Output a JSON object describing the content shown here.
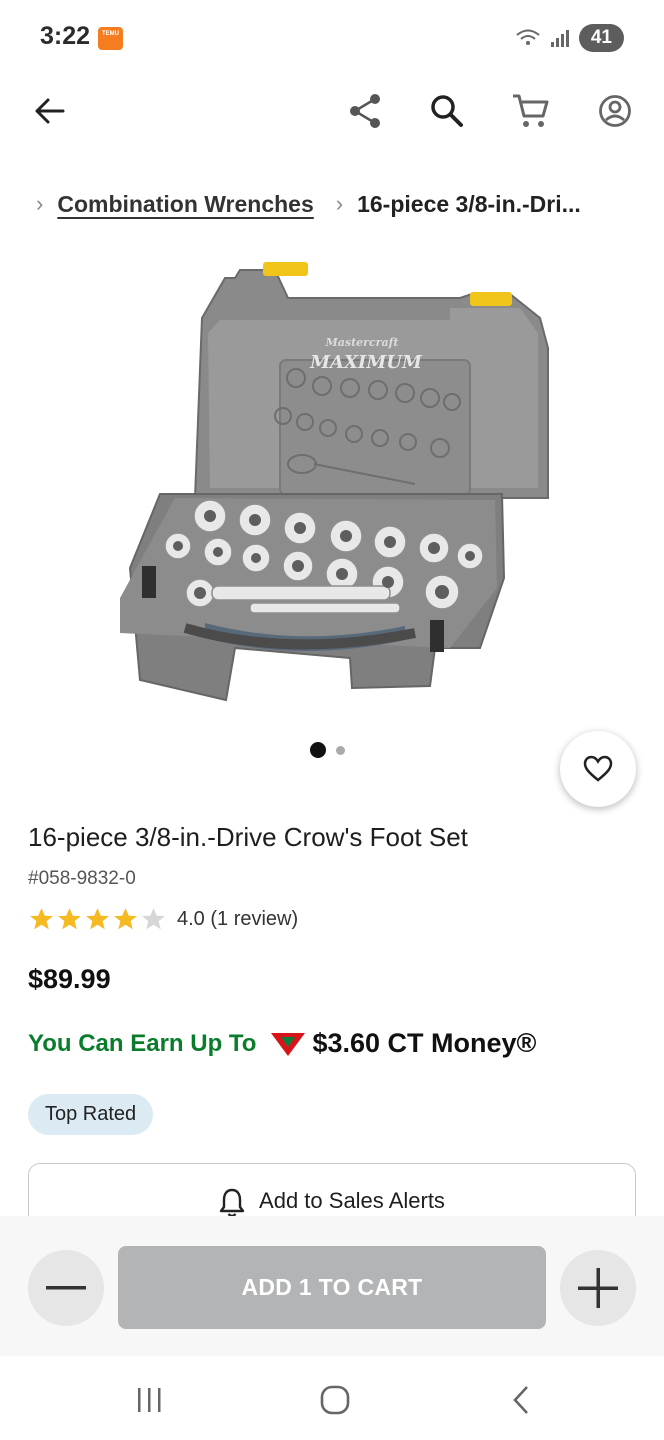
{
  "status_bar": {
    "time": "3:22",
    "app_icon_text": "TEMU",
    "battery": "41"
  },
  "top_nav": {
    "back_icon": "arrow-left-icon",
    "share_icon": "share-icon",
    "search_icon": "search-icon",
    "cart_icon": "cart-icon",
    "account_icon": "account-icon"
  },
  "breadcrumb": {
    "items": [
      {
        "label": "Combination Wrenches"
      },
      {
        "label": "16-piece 3/8-in.-Dri..."
      }
    ]
  },
  "product": {
    "image_brand_text": "Mastercraft",
    "image_model_text": "MAXIMUM",
    "image_count": 2,
    "active_image": 1,
    "title": "16-piece 3/8-in.-Drive Crow's Foot Set",
    "sku": "#058-9832-0",
    "rating": 4.0,
    "rating_text": "4.0 (1 review)",
    "price": "$89.99",
    "earn_label": "You Can Earn Up To",
    "earn_amount": "$3.60 CT Money®",
    "badge": "Top Rated"
  },
  "actions": {
    "sales_alert_label": "Add to Sales Alerts",
    "add_to_cart_label": "ADD 1 TO CART",
    "quantity": 1
  },
  "colors": {
    "earn_green": "#0a7d2c",
    "star_gold": "#f5b921",
    "ct_red": "#d7141a",
    "badge_bg": "#dcebf3",
    "disabled_button": "#b2b4b6"
  }
}
